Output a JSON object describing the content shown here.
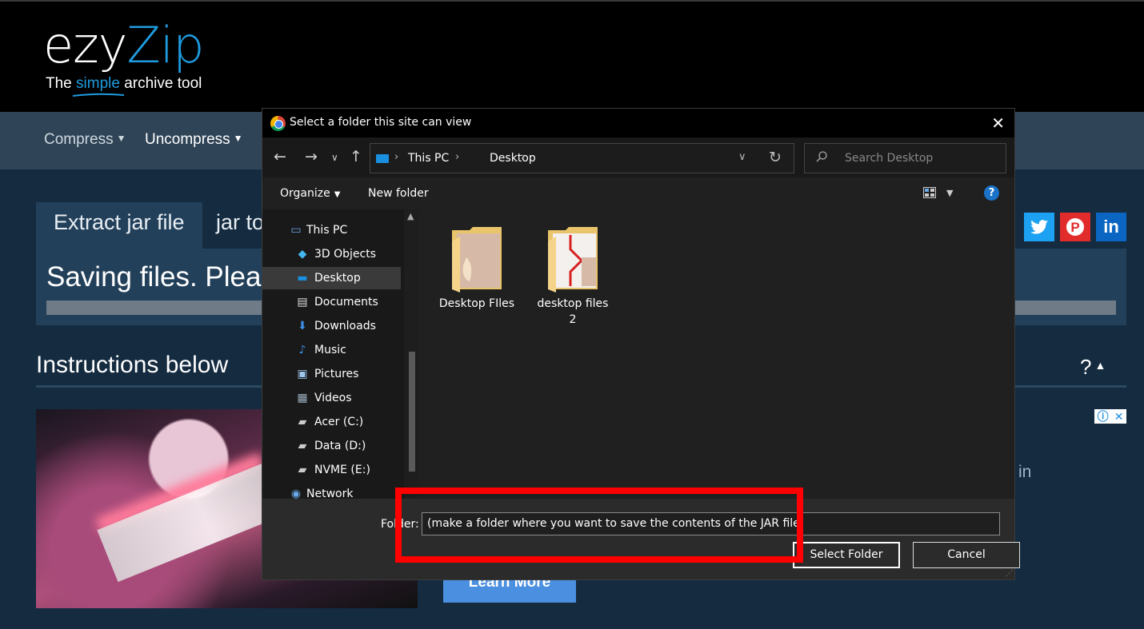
{
  "site": {
    "logo_main_a": "ezy",
    "logo_main_b": "Zip",
    "tagline_a": "The ",
    "tagline_simple": "simple",
    "tagline_b": " archive tool",
    "nav": [
      "Compress",
      "Uncompress"
    ],
    "tabs": [
      "Extract jar file",
      "jar to"
    ],
    "panel_text": "Saving files. Please",
    "section_title": "Instructions below",
    "help_toggle": "?",
    "social": {
      "twitter": "t",
      "pinterest": "P",
      "linkedin": "in"
    },
    "ad_side_text": "in",
    "ad_button": "Learn More",
    "colors": {
      "brand": "#1f9be0",
      "nav_bg": "#2f4456",
      "page_bg": "#142b40"
    }
  },
  "dialog": {
    "title": "Select a folder this site can view",
    "breadcrumb": [
      "This PC",
      "Desktop"
    ],
    "search_placeholder": "Search Desktop",
    "toolbar": {
      "organize": "Organize",
      "new_folder": "New folder",
      "help": "?"
    },
    "nav_items": [
      {
        "label": "This PC",
        "icon": "pc-icon"
      },
      {
        "label": "3D Objects",
        "icon": "cube-icon"
      },
      {
        "label": "Desktop",
        "icon": "desktop-icon",
        "selected": true
      },
      {
        "label": "Documents",
        "icon": "document-icon"
      },
      {
        "label": "Downloads",
        "icon": "download-icon"
      },
      {
        "label": "Music",
        "icon": "music-icon"
      },
      {
        "label": "Pictures",
        "icon": "picture-icon"
      },
      {
        "label": "Videos",
        "icon": "video-icon"
      },
      {
        "label": "Acer (C:)",
        "icon": "drive-icon"
      },
      {
        "label": "Data (D:)",
        "icon": "drive-icon"
      },
      {
        "label": "NVME (E:)",
        "icon": "drive-icon"
      },
      {
        "label": "Network",
        "icon": "network-icon"
      }
    ],
    "files": [
      {
        "label_lines": [
          "Desktop FIles"
        ]
      },
      {
        "label_lines": [
          "desktop files",
          "2"
        ]
      }
    ],
    "folder_label": "Folder:",
    "folder_value": "(make a folder where you want to save the contents of the JAR file)",
    "select_button": "Select Folder",
    "cancel_button": "Cancel"
  }
}
